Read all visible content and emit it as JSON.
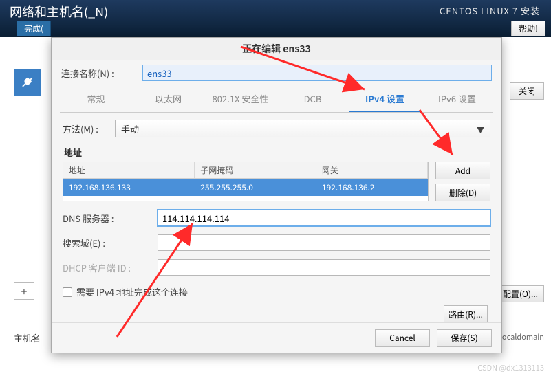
{
  "header": {
    "title": "网络和主机名(_N)",
    "install": "CENTOS LINUX 7 安装",
    "done": "完成(",
    "help": "帮助!"
  },
  "bg": {
    "close": "关闭",
    "configure": "配置(O)...",
    "plus": "+",
    "host_label": "主机名",
    "localdomain": "t.localdomain"
  },
  "dialog": {
    "title": "正在编辑 ens33",
    "conn_name_label": "连接名称(N) :",
    "conn_name_value": "ens33",
    "tabs": [
      "常规",
      "以太网",
      "802.1X 安全性",
      "DCB",
      "IPv4 设置",
      "IPv6 设置"
    ],
    "active_tab": 4,
    "method_label": "方法(M) :",
    "method_value": "手动",
    "address_section": "地址",
    "columns": {
      "addr": "地址",
      "mask": "子网掩码",
      "gw": "网关"
    },
    "rows": [
      {
        "addr": "192.168.136.133",
        "mask": "255.255.255.0",
        "gw": "192.168.136.2"
      }
    ],
    "add_btn": "Add",
    "del_btn": "删除(D)",
    "dns_label": "DNS 服务器 :",
    "dns_value": "114.114.114.114",
    "search_label": "搜索域(E) :",
    "search_value": "",
    "dhcp_label": "DHCP 客户端 ID :",
    "dhcp_value": "",
    "chk_label": "需要 IPv4 地址完成这个连接",
    "route_btn": "路由(R)...",
    "cancel": "Cancel",
    "save": "保存(S)"
  },
  "watermark": "CSDN @dx1313113"
}
